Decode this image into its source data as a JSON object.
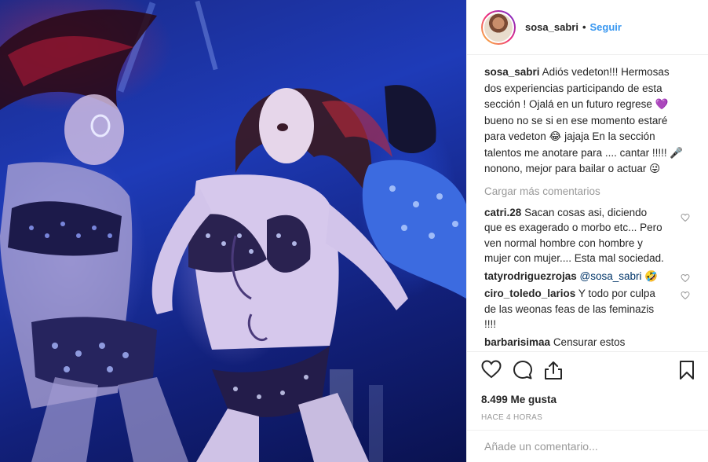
{
  "post": {
    "username": "sosa_sabri",
    "follow_label": "Seguir",
    "separator": "•",
    "caption_user": "sosa_sabri",
    "caption_text": "Adiós vedeton!!! Hermosas dos experiencias participando de esta sección ! Ojalá en un futuro regrese 💜 bueno no se si en ese momento estaré para vedeton 😂 jajaja En la sección talentos me anotare para .... cantar !!!!! 🎤 nonono, mejor para bailar o actuar 😜",
    "load_more": "Cargar más comentarios",
    "likes": "8.499 Me gusta",
    "time": "HACE 4 HORAS",
    "add_comment_placeholder": "Añade un comentario..."
  },
  "comments": [
    {
      "user": "catri.28",
      "text": "Sacan cosas asi, diciendo que es exagerado o morbo etc... Pero ven normal hombre con hombre y mujer con mujer.... Esta mal sociedad.",
      "mention": ""
    },
    {
      "user": "tatyrodriguezrojas",
      "text": "🤣",
      "mention": "@sosa_sabri"
    },
    {
      "user": "ciro_toledo_larios",
      "text": "Y todo por culpa de las weonas feas de las feminazis !!!!",
      "mention": ""
    },
    {
      "user": "barbarisimaa",
      "text": "Censurar estos espacios me hace pensar que tenemos la mente muy chica, lo digo porque hay gente que lo vulgariza, nadie se fija en los",
      "mention": ""
    }
  ],
  "icons": {
    "like": "heart-icon",
    "comment": "comment-icon",
    "share": "share-icon",
    "save": "bookmark-icon"
  },
  "colors": {
    "accent": "#3897f0",
    "muted": "#999999",
    "text": "#262626",
    "border": "#efefef"
  }
}
